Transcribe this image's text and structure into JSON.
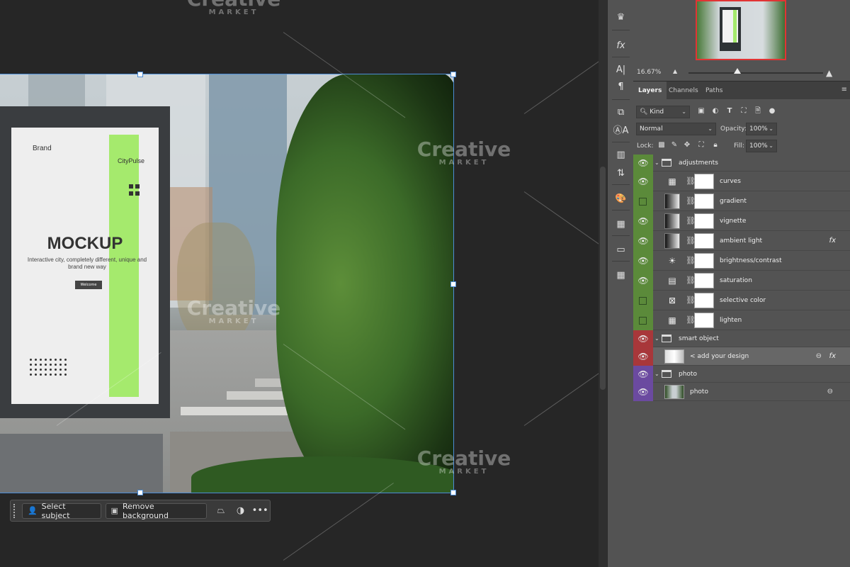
{
  "canvas": {
    "poster": {
      "brand": "Brand",
      "sub_brand": "CityPulse",
      "headline": "MOCKUP",
      "tagline": "Interactive city, completely different, unique and brand new way",
      "button": "Welcome"
    },
    "watermark": {
      "main": "Creative",
      "sub": "MARKET"
    }
  },
  "taskbar": {
    "select_subject": "Select subject",
    "remove_background": "Remove background",
    "more": "•••"
  },
  "navigator": {
    "zoom": "16.67%"
  },
  "panel_tabs": [
    "Layers",
    "Channels",
    "Paths"
  ],
  "layers_panel": {
    "filter_kind": "Kind",
    "blend_mode": "Normal",
    "opacity_label": "Opacity:",
    "opacity_value": "100%",
    "lock_label": "Lock:",
    "fill_label": "Fill:",
    "fill_value": "100%"
  },
  "layers": [
    {
      "name": "adjustments",
      "type": "group",
      "visible": true,
      "color": "#5b8a3a"
    },
    {
      "name": "curves",
      "type": "adjustment",
      "icon": "curves-icon",
      "glyph": "▦",
      "visible": true,
      "color": "#5b8a3a"
    },
    {
      "name": "gradient",
      "type": "gradient",
      "visible": false,
      "color": "#5b8a3a"
    },
    {
      "name": "vignette",
      "type": "gradient",
      "visible": true,
      "color": "#5b8a3a"
    },
    {
      "name": "ambient light",
      "type": "gradient",
      "visible": true,
      "fx": "fx",
      "color": "#5b8a3a"
    },
    {
      "name": "brightness/contrast",
      "type": "adjustment",
      "icon": "brightness-icon",
      "glyph": "☀",
      "visible": true,
      "color": "#5b8a3a"
    },
    {
      "name": "saturation",
      "type": "adjustment",
      "icon": "hue-saturation-icon",
      "glyph": "▤",
      "visible": true,
      "color": "#5b8a3a"
    },
    {
      "name": "selective color",
      "type": "adjustment",
      "icon": "selective-color-icon",
      "glyph": "⊠",
      "visible": false,
      "color": "#5b8a3a"
    },
    {
      "name": "lighten",
      "type": "adjustment",
      "icon": "curves-icon",
      "glyph": "▦",
      "visible": false,
      "color": "#5b8a3a"
    },
    {
      "name": "smart object",
      "type": "group",
      "visible": true,
      "color": "#a8373a"
    },
    {
      "name": "< add your design",
      "type": "smartobject",
      "visible": true,
      "fx": "fx",
      "color": "#a8373a"
    },
    {
      "name": "photo",
      "type": "group",
      "visible": true,
      "color": "#6b4aa0"
    },
    {
      "name": "photo",
      "type": "image",
      "visible": true,
      "color": "#6b4aa0"
    }
  ]
}
